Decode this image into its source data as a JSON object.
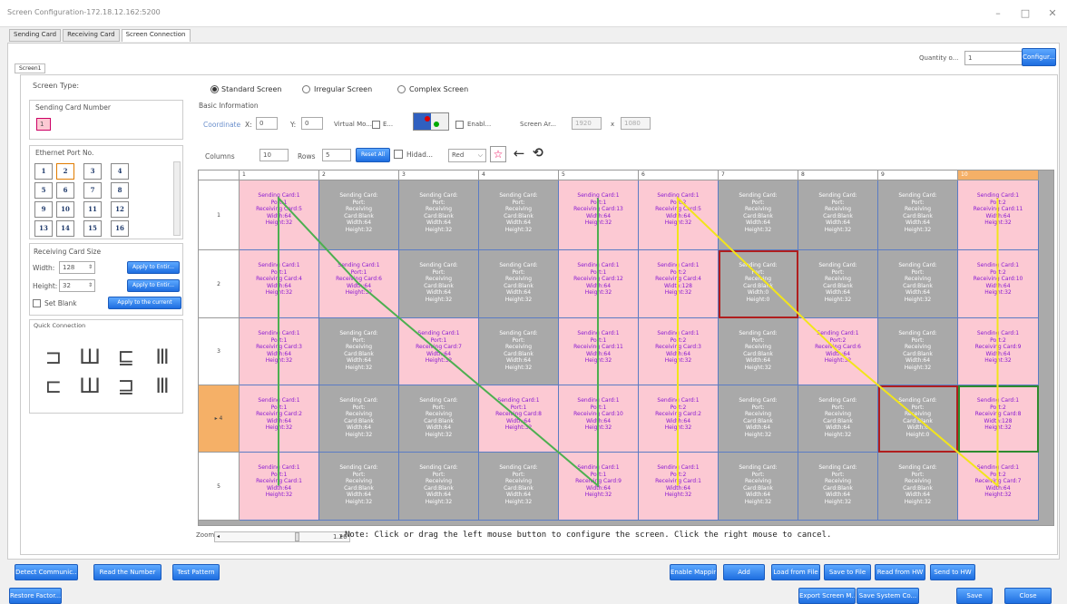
{
  "window": {
    "title": "Screen Configuration-172.18.12.162:5200"
  },
  "tabs": [
    "Sending Card",
    "Receiving Card",
    "Screen Connection"
  ],
  "screen_tab": "Screen1",
  "top_right": {
    "quantity_label": "Quantity o...",
    "quantity_value": "1",
    "configure_label": "Configur..."
  },
  "left": {
    "screen_type_label": "Screen Type:",
    "sending_card_number_label": "Sending Card Number",
    "sending_card_number_value": "1",
    "ethernet_port_label": "Ethernet Port No.",
    "ports": [
      "1",
      "2",
      "3",
      "4",
      "5",
      "6",
      "7",
      "8",
      "9",
      "10",
      "11",
      "12",
      "13",
      "14",
      "15",
      "16"
    ],
    "receiving_card_size_label": "Receiving Card Size",
    "width_label": "Width:",
    "width_value": "128",
    "height_label": "Height:",
    "height_value": "32",
    "apply_entire_label": "Apply to Entir...",
    "set_blank_label": "Set Blank",
    "apply_current_label": "Apply to the current",
    "quick_connection_label": "Quick Connection"
  },
  "screen_types": [
    "Standard Screen",
    "Irregular Screen",
    "Complex Screen"
  ],
  "basic_info_label": "Basic Information",
  "coords": {
    "label": "Coordinate",
    "x_label": "X:",
    "x_value": "0",
    "y_label": "Y:",
    "y_value": "0",
    "virtual_label": "Virtual Mo...",
    "e_label": "E...",
    "enable_label": "Enabl...",
    "screen_area_label": "Screen Ar...",
    "area_w": "1920",
    "area_sep": "x",
    "area_h": "1080"
  },
  "columns_row": {
    "columns_label": "Columns",
    "columns_value": "10",
    "rows_label": "Rows",
    "rows_value": "5",
    "reset_label": "Reset All",
    "hidden_label": "Hidad...",
    "color_value": "Red"
  },
  "grid": {
    "cols": [
      "1",
      "2",
      "3",
      "4",
      "5",
      "6",
      "7",
      "8",
      "9",
      "10"
    ],
    "rows": [
      "1",
      "2",
      "3",
      "4",
      "5"
    ],
    "row_marker": "▸ 4",
    "cells": [
      [
        [
          "Sending Card:1",
          "Port:1",
          "Receiving Card:5",
          "Width:64",
          "Height:32"
        ],
        [
          "Sending Card:",
          "Port:",
          "Receiving",
          "Card:Blank",
          "Width:64",
          "Height:32"
        ],
        [
          "Sending Card:",
          "Port:",
          "Receiving",
          "Card:Blank",
          "Width:64",
          "Height:32"
        ],
        [
          "Sending Card:",
          "Port:",
          "Receiving",
          "Card:Blank",
          "Width:64",
          "Height:32"
        ],
        [
          "Sending Card:1",
          "Port:1",
          "Receiving Card:13",
          "Width:64",
          "Height:32"
        ],
        [
          "Sending Card:1",
          "Port:2",
          "Receiving Card:5",
          "Width:64",
          "Height:32"
        ],
        [
          "Sending Card:",
          "Port:",
          "Receiving",
          "Card:Blank",
          "Width:64",
          "Height:32"
        ],
        [
          "Sending Card:",
          "Port:",
          "Receiving",
          "Card:Blank",
          "Width:64",
          "Height:32"
        ],
        [
          "Sending Card:",
          "Port:",
          "Receiving",
          "Card:Blank",
          "Width:64",
          "Height:32"
        ],
        [
          "Sending Card:1",
          "Port:2",
          "Receiving Card:11",
          "Width:64",
          "Height:32"
        ]
      ],
      [
        [
          "Sending Card:1",
          "Port:1",
          "Receiving Card:4",
          "Width:64",
          "Height:32"
        ],
        [
          "Sending Card:1",
          "Port:1",
          "Receiving Card:6",
          "Width:64",
          "Height:32"
        ],
        [
          "Sending Card:",
          "Port:",
          "Receiving",
          "Card:Blank",
          "Width:64",
          "Height:32"
        ],
        [
          "Sending Card:",
          "Port:",
          "Receiving",
          "Card:Blank",
          "Width:64",
          "Height:32"
        ],
        [
          "Sending Card:1",
          "Port:1",
          "Receiving Card:12",
          "Width:64",
          "Height:32"
        ],
        [
          "Sending Card:1",
          "Port:2",
          "Receiving Card:4",
          "Width:128",
          "Height:32"
        ],
        [
          "Sending Card:",
          "Port:",
          "Receiving",
          "Card:Blank",
          "Width:0",
          "Height:0"
        ],
        [
          "Sending Card:",
          "Port:",
          "Receiving",
          "Card:Blank",
          "Width:64",
          "Height:32"
        ],
        [
          "Sending Card:",
          "Port:",
          "Receiving",
          "Card:Blank",
          "Width:64",
          "Height:32"
        ],
        [
          "Sending Card:1",
          "Port:2",
          "Receiving Card:10",
          "Width:64",
          "Height:32"
        ]
      ],
      [
        [
          "Sending Card:1",
          "Port:1",
          "Receiving Card:3",
          "Width:64",
          "Height:32"
        ],
        [
          "Sending Card:",
          "Port:",
          "Receiving",
          "Card:Blank",
          "Width:64",
          "Height:32"
        ],
        [
          "Sending Card:1",
          "Port:1",
          "Receiving Card:7",
          "Width:64",
          "Height:32"
        ],
        [
          "Sending Card:",
          "Port:",
          "Receiving",
          "Card:Blank",
          "Width:64",
          "Height:32"
        ],
        [
          "Sending Card:1",
          "Port:1",
          "Receiving Card:11",
          "Width:64",
          "Height:32"
        ],
        [
          "Sending Card:1",
          "Port:2",
          "Receiving Card:3",
          "Width:64",
          "Height:32"
        ],
        [
          "Sending Card:",
          "Port:",
          "Receiving",
          "Card:Blank",
          "Width:64",
          "Height:32"
        ],
        [
          "Sending Card:1",
          "Port:2",
          "Receiving Card:6",
          "Width:64",
          "Height:32"
        ],
        [
          "Sending Card:",
          "Port:",
          "Receiving",
          "Card:Blank",
          "Width:64",
          "Height:32"
        ],
        [
          "Sending Card:1",
          "Port:2",
          "Receiving Card:9",
          "Width:64",
          "Height:32"
        ]
      ],
      [
        [
          "Sending Card:1",
          "Port:1",
          "Receiving Card:2",
          "Width:64",
          "Height:32"
        ],
        [
          "Sending Card:",
          "Port:",
          "Receiving",
          "Card:Blank",
          "Width:64",
          "Height:32"
        ],
        [
          "Sending Card:",
          "Port:",
          "Receiving",
          "Card:Blank",
          "Width:64",
          "Height:32"
        ],
        [
          "Sending Card:1",
          "Port:1",
          "Receiving Card:8",
          "Width:64",
          "Height:32"
        ],
        [
          "Sending Card:1",
          "Port:1",
          "Receiving Card:10",
          "Width:64",
          "Height:32"
        ],
        [
          "Sending Card:1",
          "Port:2",
          "Receiving Card:2",
          "Width:64",
          "Height:32"
        ],
        [
          "Sending Card:",
          "Port:",
          "Receiving",
          "Card:Blank",
          "Width:64",
          "Height:32"
        ],
        [
          "Sending Card:",
          "Port:",
          "Receiving",
          "Card:Blank",
          "Width:64",
          "Height:32"
        ],
        [
          "Sending Card:",
          "Port:",
          "Receiving",
          "Card:Blank",
          "Width:0",
          "Height:0"
        ],
        [
          "Sending Card:1",
          "Port:2",
          "Receiving Card:8",
          "Width:128",
          "Height:32"
        ]
      ],
      [
        [
          "Sending Card:1",
          "Port:1",
          "Receiving Card:1",
          "Width:64",
          "Height:32"
        ],
        [
          "Sending Card:",
          "Port:",
          "Receiving",
          "Card:Blank",
          "Width:64",
          "Height:32"
        ],
        [
          "Sending Card:",
          "Port:",
          "Receiving",
          "Card:Blank",
          "Width:64",
          "Height:32"
        ],
        [
          "Sending Card:",
          "Port:",
          "Receiving",
          "Card:Blank",
          "Width:64",
          "Height:32"
        ],
        [
          "Sending Card:1",
          "Port:1",
          "Receiving Card:9",
          "Width:64",
          "Height:32"
        ],
        [
          "Sending Card:1",
          "Port:2",
          "Receiving Card:1",
          "Width:64",
          "Height:32"
        ],
        [
          "Sending Card:",
          "Port:",
          "Receiving",
          "Card:Blank",
          "Width:64",
          "Height:32"
        ],
        [
          "Sending Card:",
          "Port:",
          "Receiving",
          "Card:Blank",
          "Width:64",
          "Height:32"
        ],
        [
          "Sending Card:",
          "Port:",
          "Receiving",
          "Card:Blank",
          "Width:64",
          "Height:32"
        ],
        [
          "Sending Card:1",
          "Port:2",
          "Receiving Card:7",
          "Width:64",
          "Height:32"
        ]
      ]
    ]
  },
  "zoom": {
    "label": "Zoom",
    "value": "1.26"
  },
  "note": "Note: Click or drag the left mouse button to configure the screen. Click the right mouse to cancel.",
  "bottom_buttons_row1": [
    "Detect Communic...",
    "Read the Number",
    "Test Pattern",
    "Enable Mapping",
    "Add",
    "Load from File",
    "Save to File",
    "Read from HW",
    "Send to HW"
  ],
  "bottom_buttons_row2": [
    "Restore Factor...",
    "Export Screen M...",
    "Save System Co...",
    "Save",
    "Close"
  ],
  "colors": {
    "pink": "#fcc9d3",
    "gray": "#a9a9a9",
    "accent": "#1e6ee0",
    "row_highlight": "#f5b067",
    "port1_line": "#4caf50",
    "port2_line": "#f2e51b"
  }
}
